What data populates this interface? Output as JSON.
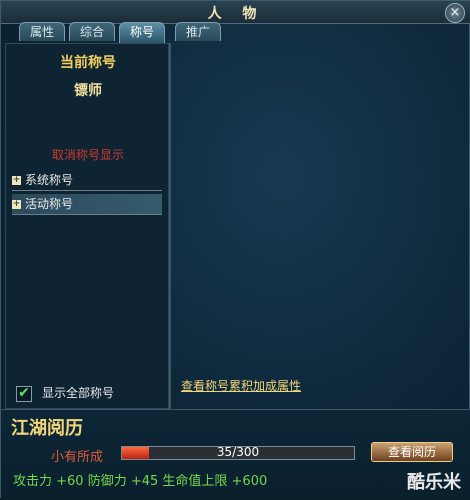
{
  "window": {
    "title": "人 物",
    "close_symbol": "×"
  },
  "tabs": [
    {
      "label": "属性"
    },
    {
      "label": "综合"
    },
    {
      "label": "称号"
    },
    {
      "label": "推广"
    }
  ],
  "left_panel": {
    "current_title_label": "当前称号",
    "current_title_value": "镖师",
    "hide_title_link": "取消称号显示",
    "categories": [
      {
        "label": "系统称号",
        "expander": "+"
      },
      {
        "label": "活动称号",
        "expander": "+"
      }
    ],
    "show_all_label": "显示全部称号",
    "show_all_checked_symbol": "✔"
  },
  "right_panel": {
    "view_attributes_link": "查看称号累积加成属性"
  },
  "jianghu": {
    "section_title": "江湖阅历",
    "rank_label": "小有所成",
    "exp_text": "35/300",
    "exp_fraction": 0.1167,
    "view_history_button": "查看阅历",
    "stats_text": "攻击力 +60 防御力 +45 生命值上限 +600"
  },
  "watermark": "酷乐米"
}
